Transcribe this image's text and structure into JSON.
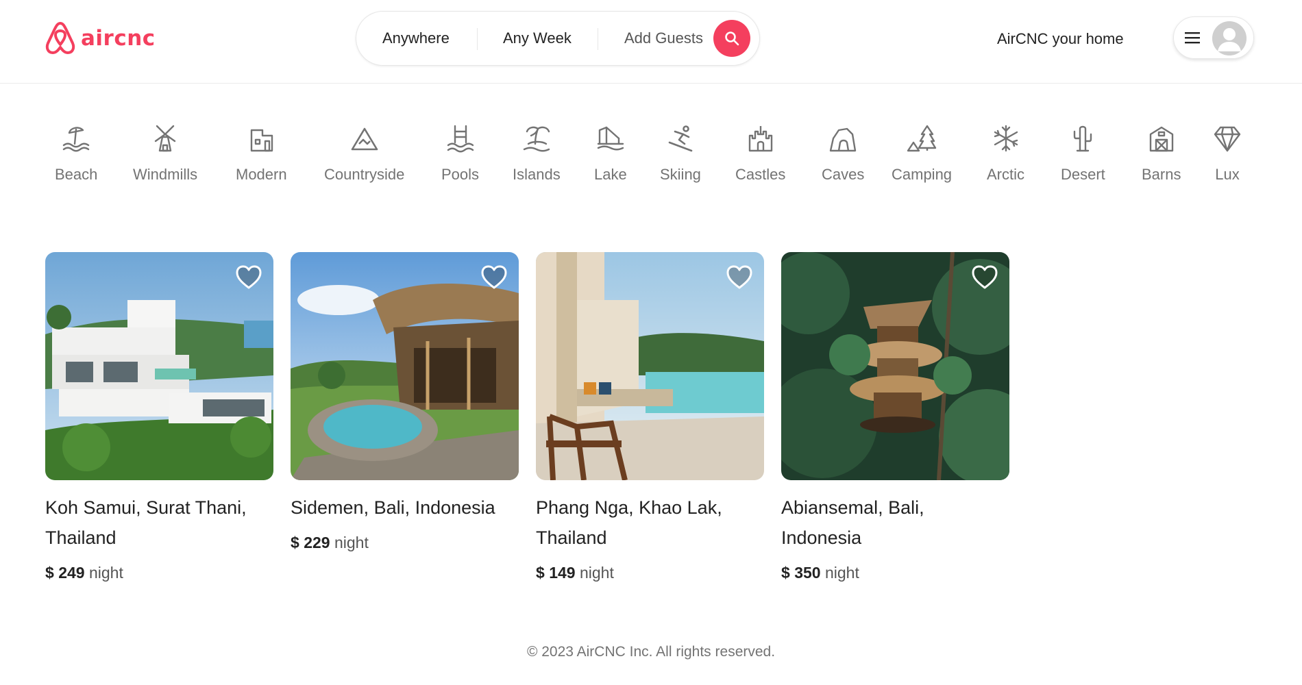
{
  "header": {
    "logo_text": "aircnc",
    "search": {
      "anywhere": "Anywhere",
      "week": "Any Week",
      "guests": "Add Guests"
    },
    "host_link": "AirCNC your home"
  },
  "categories": [
    {
      "label": "Beach",
      "icon": "beach-icon"
    },
    {
      "label": "Windmills",
      "icon": "windmill-icon"
    },
    {
      "label": "Modern",
      "icon": "modern-icon"
    },
    {
      "label": "Countryside",
      "icon": "countryside-icon"
    },
    {
      "label": "Pools",
      "icon": "pool-icon"
    },
    {
      "label": "Islands",
      "icon": "island-icon"
    },
    {
      "label": "Lake",
      "icon": "lake-icon"
    },
    {
      "label": "Skiing",
      "icon": "skiing-icon"
    },
    {
      "label": "Castles",
      "icon": "castle-icon"
    },
    {
      "label": "Caves",
      "icon": "cave-icon"
    },
    {
      "label": "Camping",
      "icon": "camping-icon"
    },
    {
      "label": "Arctic",
      "icon": "snowflake-icon"
    },
    {
      "label": "Desert",
      "icon": "cactus-icon"
    },
    {
      "label": "Barns",
      "icon": "barn-icon"
    },
    {
      "label": "Lux",
      "icon": "diamond-icon"
    }
  ],
  "listings": [
    {
      "title": "Koh Samui, Surat Thani, Thailand",
      "currency": "$",
      "price": "249",
      "unit": "night"
    },
    {
      "title": "Sidemen, Bali, Indonesia",
      "currency": "$",
      "price": "229",
      "unit": "night"
    },
    {
      "title": "Phang Nga, Khao Lak, Thailand",
      "currency": "$",
      "price": "149",
      "unit": "night"
    },
    {
      "title": "Abiansemal, Bali, Indonesia",
      "currency": "$",
      "price": "350",
      "unit": "night"
    }
  ],
  "footer": {
    "copyright": "© 2023 AirCNC Inc. All rights reserved."
  },
  "colors": {
    "brand": "#f43f5e",
    "text": "#222222",
    "muted": "#737373"
  }
}
